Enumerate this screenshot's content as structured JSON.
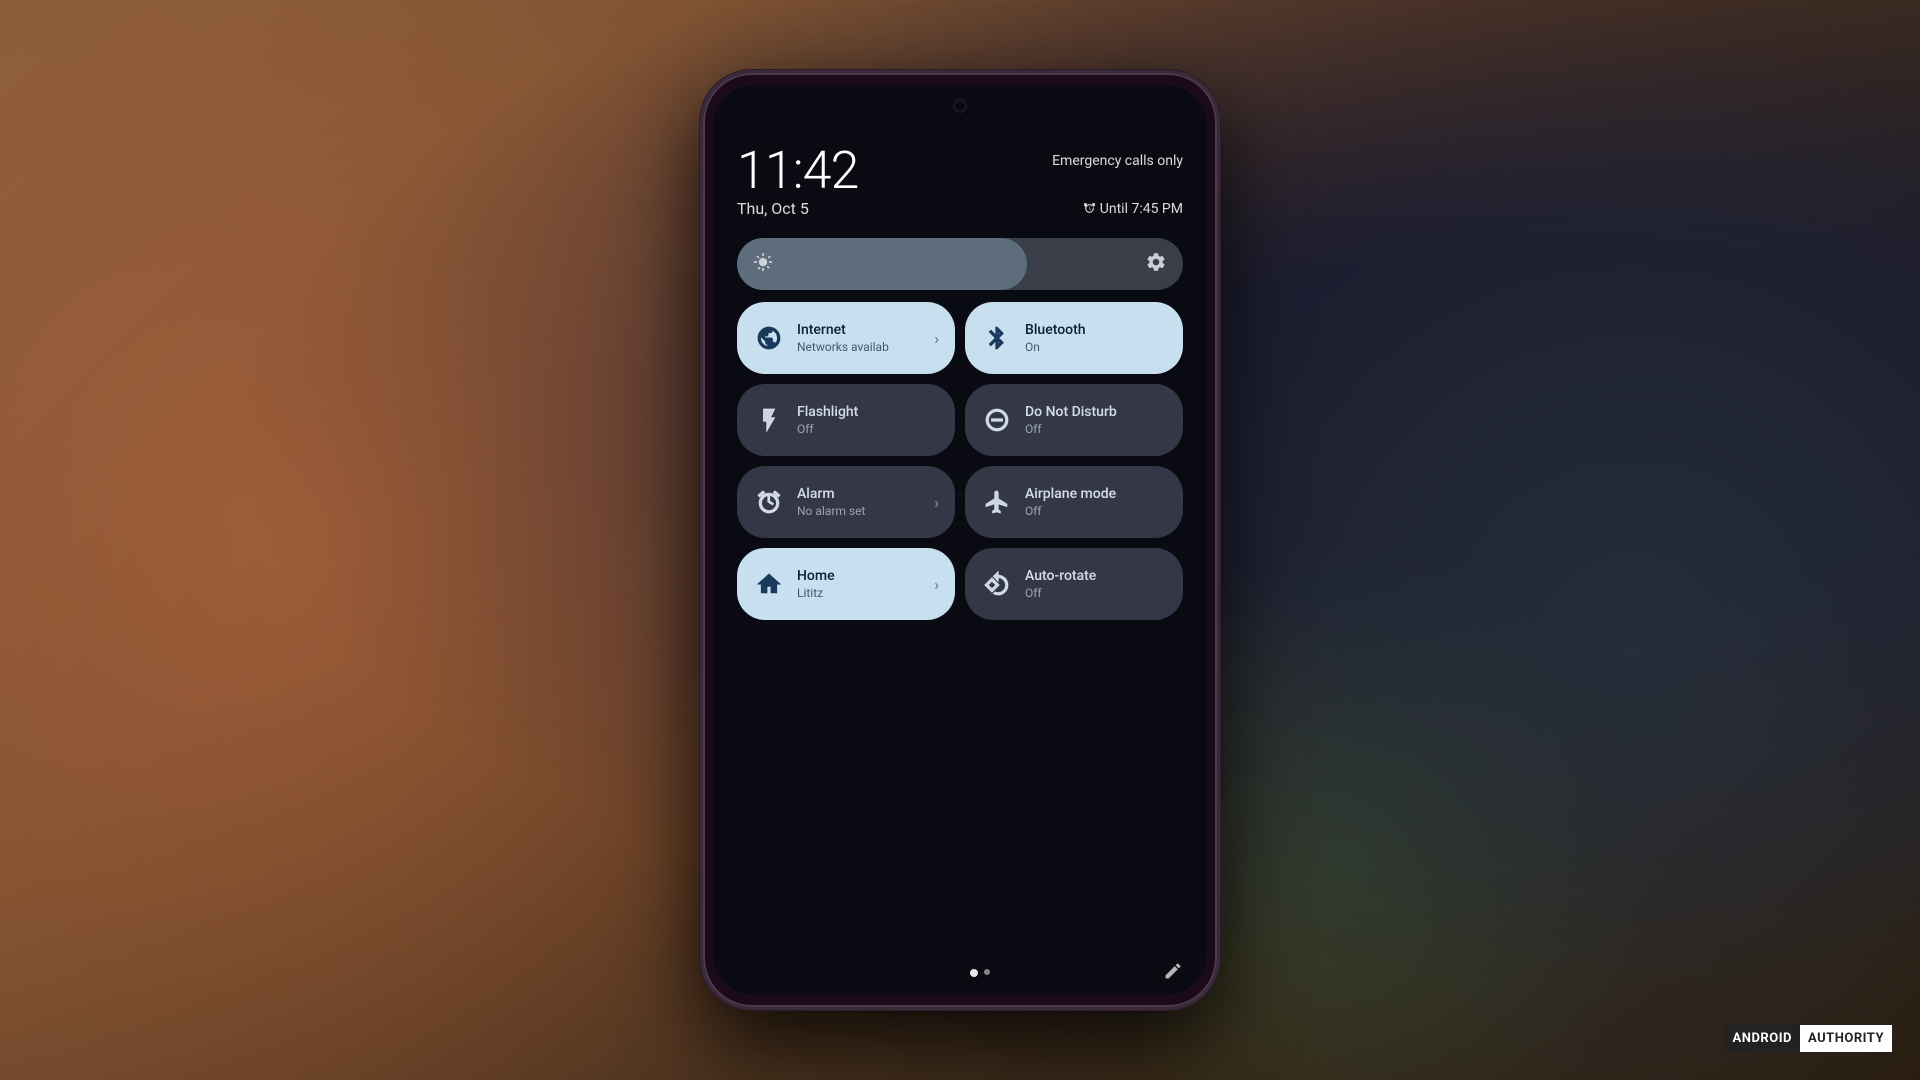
{
  "background": {
    "color": "#6b4c3b"
  },
  "watermark": {
    "android": "ANDROID",
    "authority": "AUTHORITY"
  },
  "phone": {
    "status_bar": {
      "emergency": "Emergency calls only",
      "alarm": "Until 7:45 PM"
    },
    "time": "11:42",
    "date": "Thu, Oct 5",
    "brightness": {
      "level": 65
    },
    "tiles": [
      {
        "id": "internet",
        "title": "Internet",
        "subtitle": "Networks availab",
        "state": "active",
        "has_chevron": true
      },
      {
        "id": "bluetooth",
        "title": "Bluetooth",
        "subtitle": "On",
        "state": "active",
        "has_chevron": false
      },
      {
        "id": "flashlight",
        "title": "Flashlight",
        "subtitle": "Off",
        "state": "inactive",
        "has_chevron": false
      },
      {
        "id": "do-not-disturb",
        "title": "Do Not Disturb",
        "subtitle": "Off",
        "state": "inactive",
        "has_chevron": false
      },
      {
        "id": "alarm",
        "title": "Alarm",
        "subtitle": "No alarm set",
        "state": "inactive",
        "has_chevron": true
      },
      {
        "id": "airplane-mode",
        "title": "Airplane mode",
        "subtitle": "Off",
        "state": "inactive",
        "has_chevron": false
      },
      {
        "id": "home",
        "title": "Home",
        "subtitle": "Lititz",
        "state": "active",
        "has_chevron": true
      },
      {
        "id": "auto-rotate",
        "title": "Auto-rotate",
        "subtitle": "Off",
        "state": "inactive",
        "has_chevron": false
      }
    ],
    "bottom_nav": {
      "dots": 2,
      "active_dot": 1
    }
  }
}
